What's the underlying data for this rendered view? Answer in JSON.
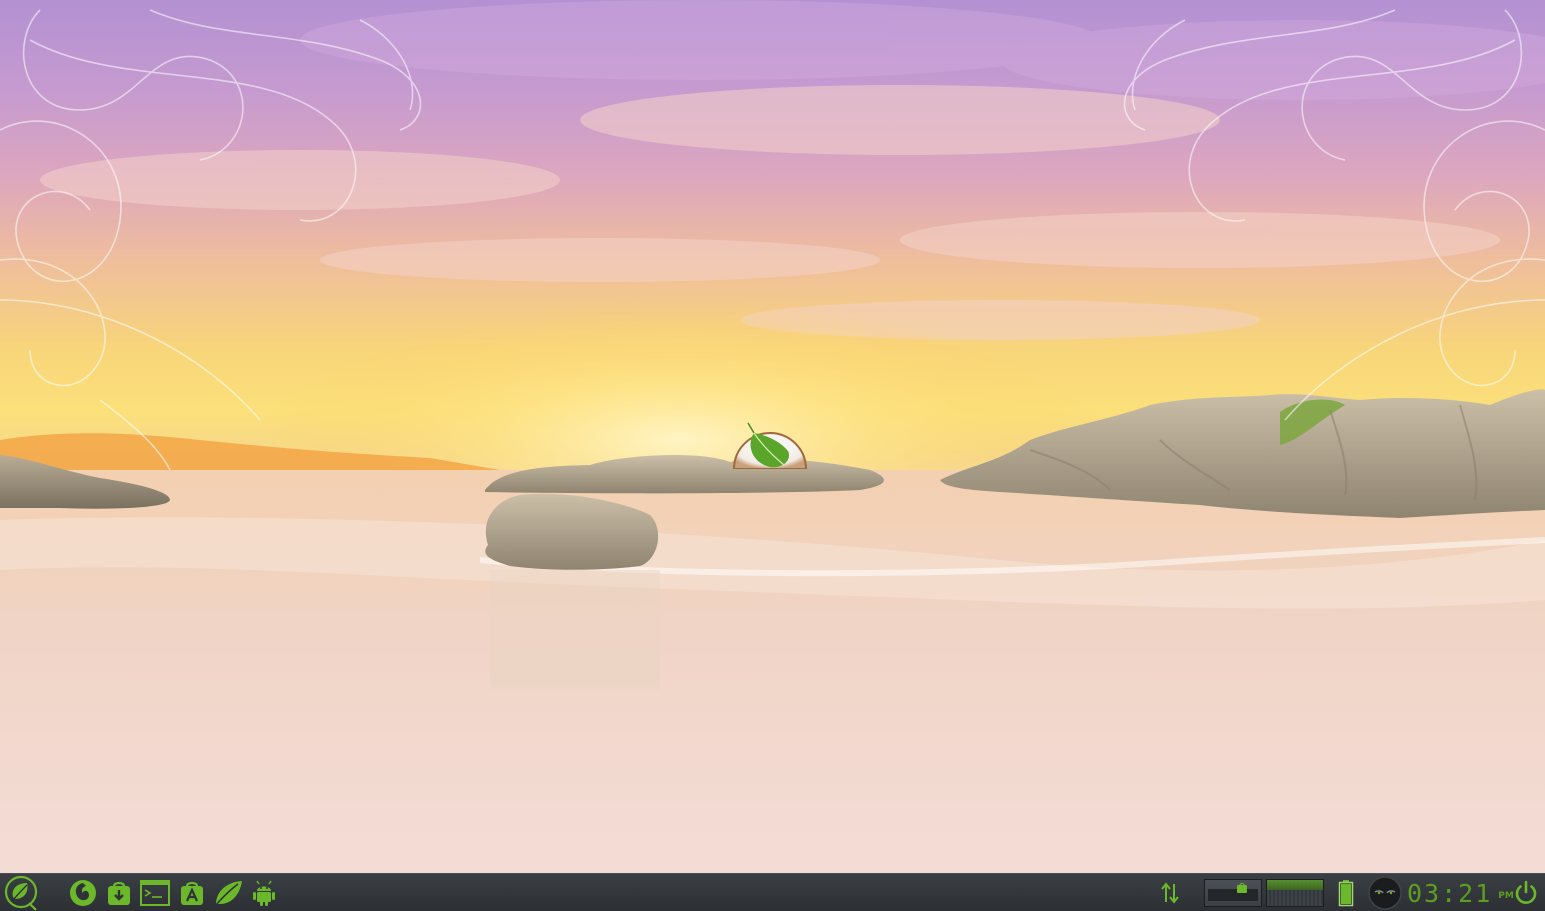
{
  "colors": {
    "accent": "#6cb82b",
    "taskbar_bg": "#2f3337"
  },
  "taskbar": {
    "launchers": [
      {
        "name": "start-menu",
        "icon": "leaf-circle-icon"
      },
      {
        "name": "firefox",
        "icon": "firefox-icon"
      },
      {
        "name": "package-installer",
        "icon": "download-bag-icon"
      },
      {
        "name": "terminal",
        "icon": "terminal-icon"
      },
      {
        "name": "app-store",
        "icon": "app-store-bag-icon"
      },
      {
        "name": "feather",
        "icon": "leaf-icon"
      },
      {
        "name": "android",
        "icon": "android-icon"
      }
    ],
    "tray": {
      "network_icon": "network-arrows-icon",
      "battery_icon": "battery-icon",
      "power_icon": "power-icon"
    },
    "clock": {
      "time": "03:21",
      "ampm": "PM"
    }
  }
}
